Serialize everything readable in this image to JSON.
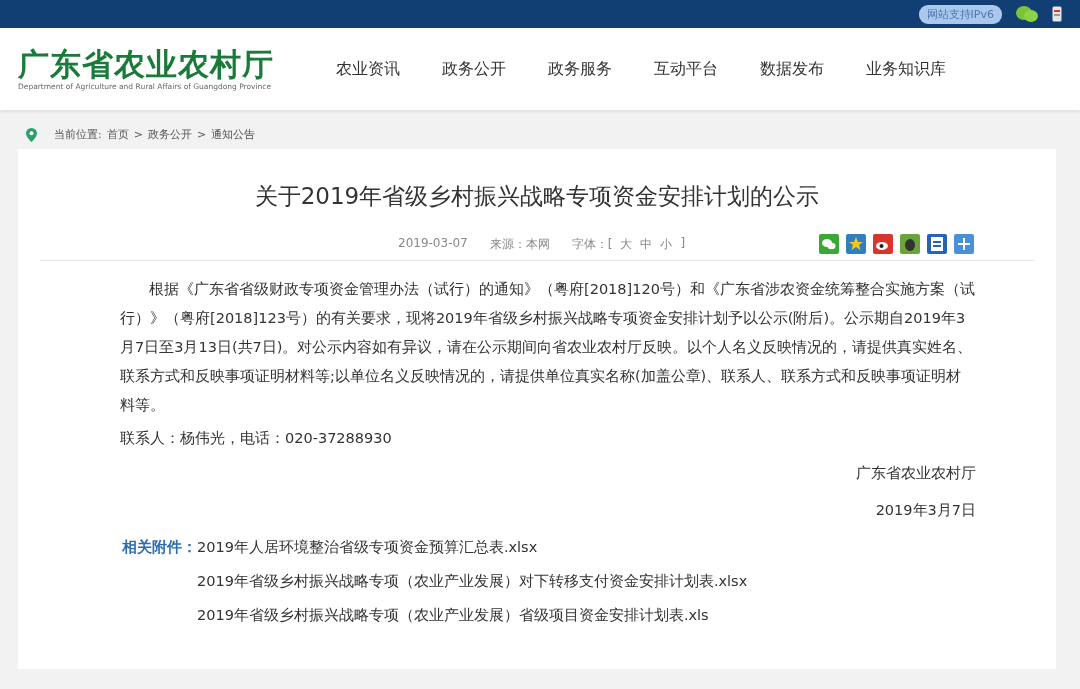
{
  "top_bar": {
    "badge": "网站支持IPv6"
  },
  "header": {
    "logo_title": "广东省农业农村厅",
    "logo_subtitle": "Department of Agriculture and Rural Affairs of Guangdong Province",
    "nav": [
      {
        "label": "农业资讯"
      },
      {
        "label": "政务公开"
      },
      {
        "label": "政务服务"
      },
      {
        "label": "互动平台"
      },
      {
        "label": "数据发布"
      },
      {
        "label": "业务知识库"
      }
    ]
  },
  "breadcrumb": {
    "prefix": "当前位置:",
    "items": [
      "首页",
      "政务公开",
      "通知公告"
    ],
    "separator": ">"
  },
  "article": {
    "title": "关于2019年省级乡村振兴战略专项资金安排计划的公示",
    "date": "2019-03-07",
    "source": "来源：本网",
    "font_label": "字体：[",
    "font_sizes": [
      "大",
      "中",
      "小"
    ],
    "font_close": "]",
    "paragraph": "根据《广东省省级财政专项资金管理办法（试行）的通知》（粤府[2018]120号）和《广东省涉农资金统筹整合实施方案（试行）》（粤府[2018]123号）的有关要求，现将2019年省级乡村振兴战略专项资金安排计划予以公示(附后)。公示期自2019年3月7日至3月13日(共7日)。对公示内容如有异议，请在公示期间向省农业农村厅反映。以个人名义反映情况的，请提供真实姓名、联系方式和反映事项证明材料等;以单位名义反映情况的，请提供单位真实名称(加盖公章)、联系人、联系方式和反映事项证明材料等。",
    "contact": "联系人：杨伟光，电话：020-37288930",
    "signature": "广东省农业农村厅",
    "signature_date": "2019年3月7日",
    "attachments_label": "相关附件：",
    "attachments": [
      "2019年人居环境整治省级专项资金预算汇总表.xlsx",
      "2019年省级乡村振兴战略专项（农业产业发展）对下转移支付资金安排计划表.xlsx",
      "2019年省级乡村振兴战略专项（农业产业发展）省级项目资金安排计划表.xls"
    ]
  }
}
